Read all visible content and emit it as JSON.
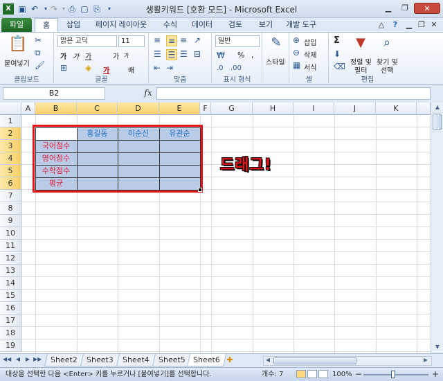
{
  "window": {
    "title": "생활키워드 [호환 모드] - Microsoft Excel",
    "qat_icons": [
      "excel-logo-icon",
      "save-icon",
      "undo-icon",
      "redo-icon",
      "print-preview-icon",
      "new-icon",
      "print-icon",
      "customize-icon"
    ]
  },
  "ribbon": {
    "tabs": [
      "파일",
      "홈",
      "삽입",
      "페이지 레이아웃",
      "수식",
      "데이터",
      "검토",
      "보기",
      "개발 도구"
    ],
    "active_tab": "홈",
    "clipboard": {
      "paste_label": "붙여넣기",
      "group_label": "클립보드"
    },
    "font": {
      "name": "맑은 고딕",
      "size": "11",
      "bold": "가",
      "italic": "가",
      "underline": "가",
      "grow": "가",
      "shrink": "가",
      "fontcolor_glyph": "가",
      "phonetic": "배",
      "group_label": "글꼴"
    },
    "alignment": {
      "group_label": "맞춤"
    },
    "number": {
      "format": "일반",
      "percent": "%",
      "comma": ",",
      "group_label": "표시 형식"
    },
    "styles": {
      "label": "스타일",
      "group_label": ""
    },
    "cells": {
      "insert": "삽입",
      "delete": "삭제",
      "format": "서식",
      "group_label": "셀"
    },
    "editing": {
      "sort_label": "정렬 및",
      "sort_label2": "필터",
      "find_label": "찾기 및",
      "find_label2": "선택",
      "sum_glyph": "Σ",
      "group_label": "편집"
    }
  },
  "formula_bar": {
    "name_box": "B2",
    "fx": "fx",
    "value": ""
  },
  "grid": {
    "columns": [
      "A",
      "B",
      "C",
      "D",
      "E",
      "F",
      "G",
      "H",
      "I",
      "J",
      "K"
    ],
    "rows": [
      "1",
      "2",
      "3",
      "4",
      "5",
      "6",
      "7",
      "8",
      "9",
      "10",
      "11",
      "12",
      "13",
      "14",
      "15",
      "16",
      "17",
      "18",
      "19"
    ],
    "header_row": [
      "홍길동",
      "이순신",
      "유관순"
    ],
    "row_labels": [
      "국어점수",
      "영어점수",
      "수학점수",
      "평균"
    ],
    "annotation": "드래그!",
    "colors": {
      "selection": "#b9cbe6",
      "frame": "#e2141a",
      "header_text": "#1f6fc6",
      "row_text": "#e0223c"
    }
  },
  "sheets": {
    "tabs": [
      "Sheet2",
      "Sheet3",
      "Sheet4",
      "Sheet5",
      "Sheet6"
    ],
    "active": "Sheet6"
  },
  "status": {
    "message": "대상을 선택한 다음 <Enter> 키를 누르거나 [붙여넣기]를 선택합니다.",
    "count": "개수: 7",
    "zoom": "100%",
    "zoom_minus": "−",
    "zoom_plus": "+"
  }
}
